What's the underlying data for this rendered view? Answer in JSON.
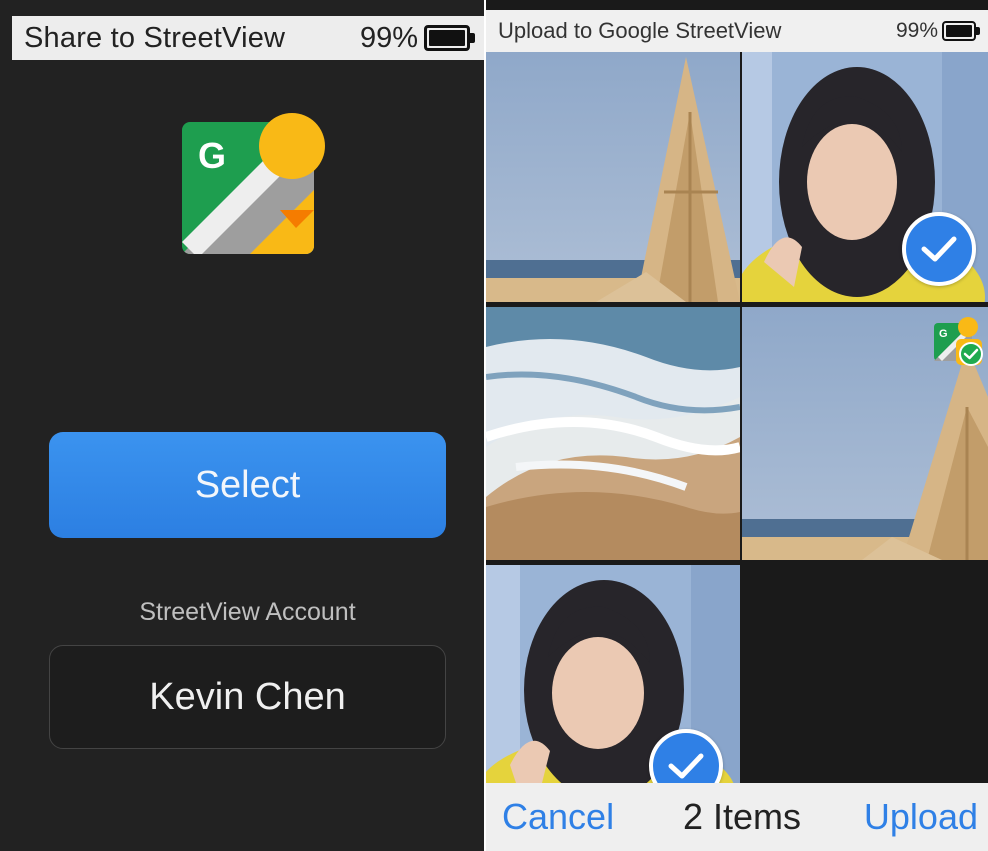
{
  "left_screen": {
    "status": {
      "title": "Share to StreetView",
      "battery_percent": "99%"
    },
    "app_icon": "google-streetview-icon",
    "select_button": "Select",
    "account_label": "StreetView Account",
    "account_name": "Kevin Chen"
  },
  "right_screen": {
    "status": {
      "title": "Upload to Google StreetView",
      "battery_percent": "99%"
    },
    "photos": [
      {
        "subject": "wooden-structure-by-sea",
        "selected": false
      },
      {
        "subject": "woman-portrait",
        "selected": true
      },
      {
        "subject": "ocean-waves-beach",
        "selected": false
      },
      {
        "subject": "wooden-structure-by-sea",
        "selected": false,
        "badge": "streetview-uploaded-icon"
      },
      {
        "subject": "woman-portrait",
        "selected": true
      }
    ],
    "bottom_bar": {
      "cancel": "Cancel",
      "count": "2 Items",
      "upload": "Upload"
    }
  },
  "colors": {
    "accent_blue": "#2f80e6",
    "dark_background": "#222222",
    "status_bar": "#ededed"
  }
}
